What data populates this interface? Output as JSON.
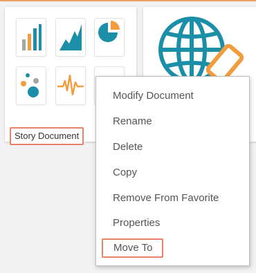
{
  "card": {
    "label": "Story Document",
    "tiles": [
      {
        "icon": "bar-chart-icon"
      },
      {
        "icon": "area-chart-icon"
      },
      {
        "icon": "pie-chart-icon"
      },
      {
        "icon": "bubble-chart-icon"
      },
      {
        "icon": "pulse-line-icon"
      },
      {
        "icon": "blank-tile"
      }
    ]
  },
  "second_card": {
    "icon": "globe-icon",
    "badge_icon": "edit-icon"
  },
  "context_menu": {
    "items": [
      {
        "label": "Modify Document"
      },
      {
        "label": "Rename"
      },
      {
        "label": "Delete"
      },
      {
        "label": "Copy"
      },
      {
        "label": "Remove From Favorite"
      },
      {
        "label": "Properties"
      },
      {
        "label": "Move To",
        "highlighted": true
      }
    ]
  },
  "colors": {
    "teal": "#1b8fa8",
    "grey": "#a5a5a5",
    "orange": "#f39c3d",
    "highlight_border": "#e8826b",
    "top_accent": "#f0a060"
  }
}
